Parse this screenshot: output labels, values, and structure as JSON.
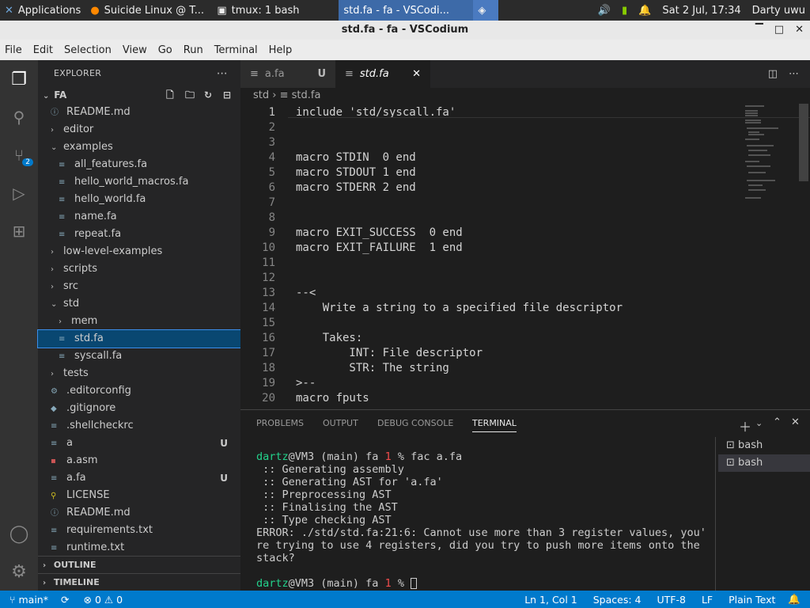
{
  "system": {
    "tasks": [
      {
        "label": "Applications"
      },
      {
        "label": "Suicide Linux @ T..."
      },
      {
        "label": "tmux: 1 bash"
      },
      {
        "label": "std.fa - fa - VSCodi..."
      }
    ],
    "datetime": "Sat  2 Jul, 17:34",
    "user": "Darty uwu"
  },
  "window": {
    "title": "std.fa - fa - VSCodium"
  },
  "menu": [
    "File",
    "Edit",
    "Selection",
    "View",
    "Go",
    "Run",
    "Terminal",
    "Help"
  ],
  "activity": {
    "scm_badge": "2"
  },
  "explorer": {
    "title": "EXPLORER",
    "root": "FA",
    "items": [
      {
        "label": "README.md",
        "depth": 1,
        "type": "file",
        "icon": "info-icon"
      },
      {
        "label": "editor",
        "depth": 1,
        "type": "folder",
        "open": false
      },
      {
        "label": "examples",
        "depth": 1,
        "type": "folder",
        "open": true
      },
      {
        "label": "all_features.fa",
        "depth": 2,
        "type": "file"
      },
      {
        "label": "hello_world_macros.fa",
        "depth": 2,
        "type": "file"
      },
      {
        "label": "hello_world.fa",
        "depth": 2,
        "type": "file"
      },
      {
        "label": "name.fa",
        "depth": 2,
        "type": "file"
      },
      {
        "label": "repeat.fa",
        "depth": 2,
        "type": "file"
      },
      {
        "label": "low-level-examples",
        "depth": 1,
        "type": "folder",
        "open": false
      },
      {
        "label": "scripts",
        "depth": 1,
        "type": "folder",
        "open": false
      },
      {
        "label": "src",
        "depth": 1,
        "type": "folder",
        "open": false
      },
      {
        "label": "std",
        "depth": 1,
        "type": "folder",
        "open": true
      },
      {
        "label": "mem",
        "depth": 2,
        "type": "folder",
        "open": false
      },
      {
        "label": "std.fa",
        "depth": 2,
        "type": "file",
        "selected": true
      },
      {
        "label": "syscall.fa",
        "depth": 2,
        "type": "file"
      },
      {
        "label": "tests",
        "depth": 1,
        "type": "folder",
        "open": false
      },
      {
        "label": ".editorconfig",
        "depth": 1,
        "type": "file",
        "icon": "gear-icon"
      },
      {
        "label": ".gitignore",
        "depth": 1,
        "type": "file",
        "icon": "dot-icon"
      },
      {
        "label": ".shellcheckrc",
        "depth": 1,
        "type": "file"
      },
      {
        "label": "a",
        "depth": 1,
        "type": "file",
        "badge": "U"
      },
      {
        "label": "a.asm",
        "depth": 1,
        "type": "file",
        "icon": "asm-icon"
      },
      {
        "label": "a.fa",
        "depth": 1,
        "type": "file",
        "badge": "U"
      },
      {
        "label": "LICENSE",
        "depth": 1,
        "type": "file",
        "icon": "license-icon"
      },
      {
        "label": "README.md",
        "depth": 1,
        "type": "file",
        "icon": "info-icon"
      },
      {
        "label": "requirements.txt",
        "depth": 1,
        "type": "file"
      },
      {
        "label": "runtime.txt",
        "depth": 1,
        "type": "file"
      }
    ],
    "outline": "OUTLINE",
    "timeline": "TIMELINE"
  },
  "tabs": [
    {
      "label": "a.fa",
      "status": "U",
      "active": false
    },
    {
      "label": "std.fa",
      "active": true
    }
  ],
  "breadcrumb": [
    "std",
    "std.fa"
  ],
  "code": [
    "include 'std/syscall.fa'",
    "",
    "",
    "macro STDIN  0 end",
    "macro STDOUT 1 end",
    "macro STDERR 2 end",
    "",
    "",
    "macro EXIT_SUCCESS  0 end",
    "macro EXIT_FAILURE  1 end",
    "",
    "",
    "--<",
    "    Write a string to a specified file descriptor",
    "",
    "    Takes:",
    "        INT: File descriptor",
    "        STR: The string",
    ">--",
    "macro fputs"
  ],
  "panel": {
    "tabs": [
      "PROBLEMS",
      "OUTPUT",
      "DEBUG CONSOLE",
      "TERMINAL"
    ],
    "prompt_user": "dartz",
    "prompt_host": "@VM3 (main) fa ",
    "prompt_code": "1",
    "prompt_sym": " %",
    "command": " fac a.fa",
    "output": [
      " :: Generating assembly",
      " :: Generating AST for 'a.fa'",
      " :: Preprocessing AST",
      " :: Finalising the AST",
      " :: Type checking AST",
      "ERROR: ./std/std.fa:21:6: Cannot use more than 3 register values, you'",
      "re trying to use 4 registers, did you try to push more items onto the",
      "stack?"
    ],
    "shells": [
      "bash",
      "bash"
    ]
  },
  "status": {
    "branch": "main*",
    "errors": "0",
    "warnings": "0",
    "position": "Ln 1, Col 1",
    "spaces": "Spaces: 4",
    "encoding": "UTF-8",
    "eol": "LF",
    "language": "Plain Text"
  }
}
